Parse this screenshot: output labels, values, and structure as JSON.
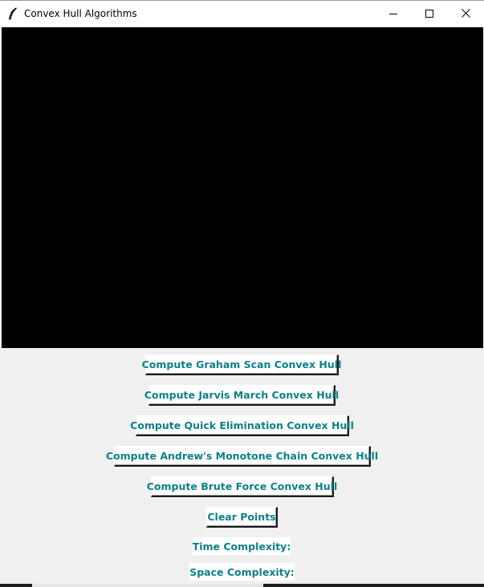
{
  "window": {
    "title": "Convex Hull Algorithms",
    "icon": "feather-icon",
    "controls": {
      "minimize_icon": "minimize-icon",
      "maximize_icon": "maximize-icon",
      "close_icon": "close-icon"
    }
  },
  "canvas": {
    "background": "#000000"
  },
  "buttons": {
    "graham": "Compute Graham Scan Convex Hull",
    "jarvis": "Compute Jarvis March Convex Hull",
    "quick": "Compute Quick Elimination Convex Hull",
    "andrew": "Compute Andrew's Monotone Chain Convex Hull",
    "brute": "Compute Brute Force Convex Hull",
    "clear": "Clear Points"
  },
  "info": {
    "time_label": "Time Complexity:",
    "space_label": "Space Complexity:"
  },
  "colors": {
    "accent_text": "#0d7f87",
    "window_bg": "#f0f0f0",
    "button_bg": "#ffffff"
  }
}
